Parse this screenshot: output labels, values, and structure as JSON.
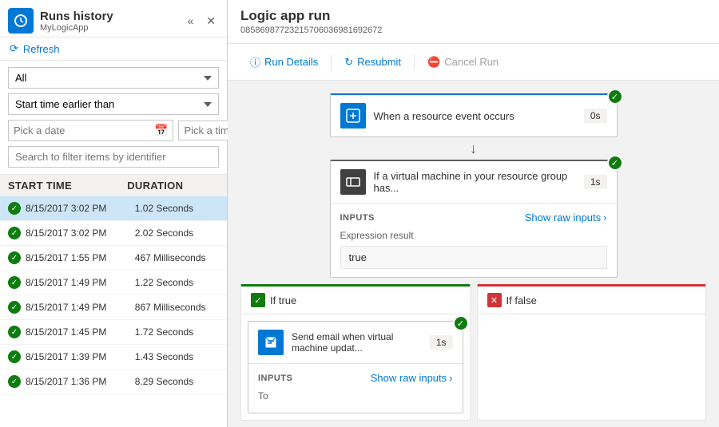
{
  "left_panel": {
    "title": "Runs history",
    "subtitle": "MyLogicApp",
    "collapse_label": "«",
    "close_label": "✕",
    "refresh_label": "Refresh",
    "filter": {
      "all_option": "All",
      "start_time_label": "Start time earlier than",
      "date_placeholder": "Pick a date",
      "time_placeholder": "Pick a time",
      "search_placeholder": "Search to filter items by identifier"
    },
    "table_headers": {
      "start_time": "START TIME",
      "duration": "DURATION"
    },
    "runs": [
      {
        "start": "8/15/2017 3:02 PM",
        "duration": "1.02 Seconds",
        "selected": true
      },
      {
        "start": "8/15/2017 3:02 PM",
        "duration": "2.02 Seconds",
        "selected": false
      },
      {
        "start": "8/15/2017 1:55 PM",
        "duration": "467 Milliseconds",
        "selected": false
      },
      {
        "start": "8/15/2017 1:49 PM",
        "duration": "1.22 Seconds",
        "selected": false
      },
      {
        "start": "8/15/2017 1:49 PM",
        "duration": "867 Milliseconds",
        "selected": false
      },
      {
        "start": "8/15/2017 1:45 PM",
        "duration": "1.72 Seconds",
        "selected": false
      },
      {
        "start": "8/15/2017 1:39 PM",
        "duration": "1.43 Seconds",
        "selected": false
      },
      {
        "start": "8/15/2017 1:36 PM",
        "duration": "8.29 Seconds",
        "selected": false
      }
    ]
  },
  "right_panel": {
    "title": "Logic app run",
    "subtitle": "08586987723215706036981692672",
    "toolbar": {
      "run_details": "Run Details",
      "resubmit": "Resubmit",
      "cancel_run": "Cancel Run"
    },
    "nodes": {
      "trigger": {
        "label": "When a resource event occurs",
        "duration": "0s"
      },
      "condition": {
        "label": "If a virtual machine in your resource group has...",
        "duration": "1s",
        "inputs_label": "INPUTS",
        "show_raw": "Show raw inputs",
        "expr_label": "Expression result",
        "expr_value": "true"
      },
      "branch_true": {
        "label": "If true"
      },
      "branch_false": {
        "label": "If false"
      },
      "action": {
        "label": "Send email when virtual machine updat...",
        "duration": "1s",
        "inputs_label": "INPUTS",
        "show_raw": "Show raw inputs",
        "to_label": "To"
      }
    }
  }
}
